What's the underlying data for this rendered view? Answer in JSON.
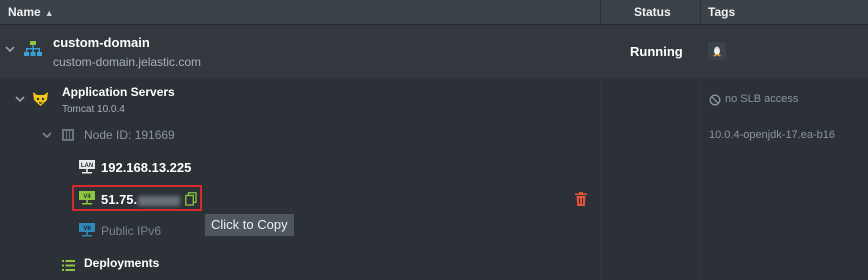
{
  "header": {
    "name_label": "Name",
    "sort_indicator": "▲",
    "status_label": "Status",
    "tags_label": "Tags"
  },
  "environment": {
    "name": "custom-domain",
    "domain": "custom-domain.jelastic.com",
    "status": "Running",
    "tag_icon": "linux-icon"
  },
  "app_servers": {
    "title": "Application Servers",
    "subtitle": "Tomcat 10.0.4",
    "slb_tag": "no SLB access",
    "icon": "tomcat-icon"
  },
  "node": {
    "id_label": "Node ID: 191669",
    "tag": "10.0.4-openjdk-17.ea-b16"
  },
  "lan_ip": {
    "badge": "LAN",
    "address": "192.168.13.225"
  },
  "public_ipv4": {
    "badge": "V4",
    "address_visible": "51.75."
  },
  "public_ipv6": {
    "badge": "V6",
    "label": "Public IPv6"
  },
  "tooltip": {
    "text": "Click to Copy"
  },
  "deployments": {
    "label": "Deployments"
  },
  "colors": {
    "accent_green": "#8cc63f",
    "delete_red": "#e5533d",
    "highlight": "#d42a2a"
  }
}
